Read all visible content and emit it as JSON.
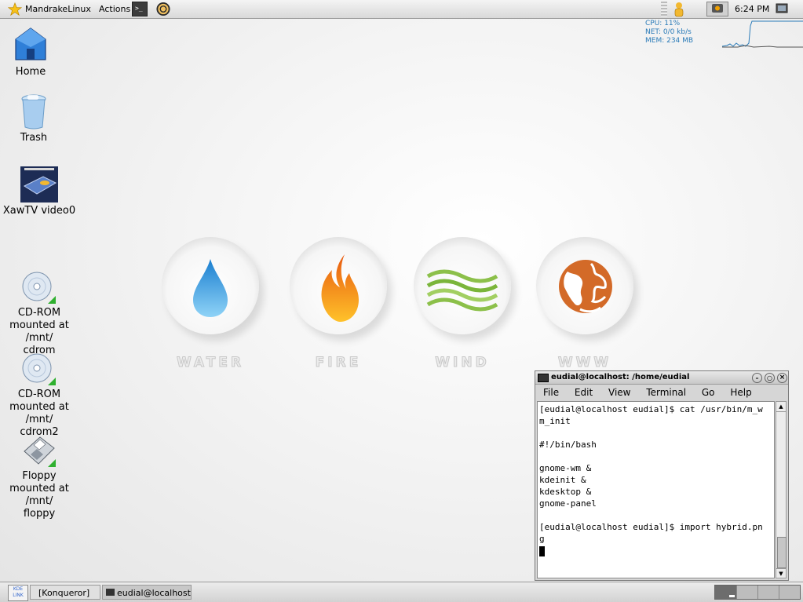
{
  "top_panel": {
    "menu_label": "MandrakeLinux",
    "actions_label": "Actions",
    "clock": "6:24 PM"
  },
  "system_monitor": {
    "cpu": "CPU: 11%",
    "net": "NET: 0/0 kb/s",
    "mem": "MEM: 234 MB"
  },
  "desktop_icons": {
    "home": "Home",
    "trash": "Trash",
    "xawtv": "XawTV video0",
    "cdrom_line1": "CD-ROM",
    "cdrom_line2": "mounted at /mnt/",
    "cdrom_line3": "cdrom",
    "cdrom2_line1": "CD-ROM",
    "cdrom2_line2": "mounted at /mnt/",
    "cdrom2_line3": "cdrom2",
    "floppy_line1": "Floppy",
    "floppy_line2": "mounted at /mnt/",
    "floppy_line3": "floppy"
  },
  "wallpaper": {
    "water": "WATER",
    "fire": "FIRE",
    "wind": "WIND",
    "www": "WWW"
  },
  "terminal": {
    "title": "eudial@localhost: /home/eudial",
    "menu": [
      "File",
      "Edit",
      "View",
      "Terminal",
      "Go",
      "Help"
    ],
    "output": "[eudial@localhost eudial]$ cat /usr/bin/m_w\nm_init\n\n#!/bin/bash\n\ngnome-wm &\nkdeinit &\nkdesktop &\ngnome-panel\n\n[eudial@localhost eudial]$ import hybrid.pn\ng"
  },
  "taskbar": {
    "kde_line1": "KDE",
    "kde_line2": "LINK",
    "task1": "[Konqueror]",
    "task2": "eudial@localhost: ,"
  },
  "colors": {
    "accent": "#2a7bb8",
    "water": "#3aa6e2",
    "fire": "#f28a1c",
    "wind": "#8cc04a",
    "www": "#d36a28"
  }
}
